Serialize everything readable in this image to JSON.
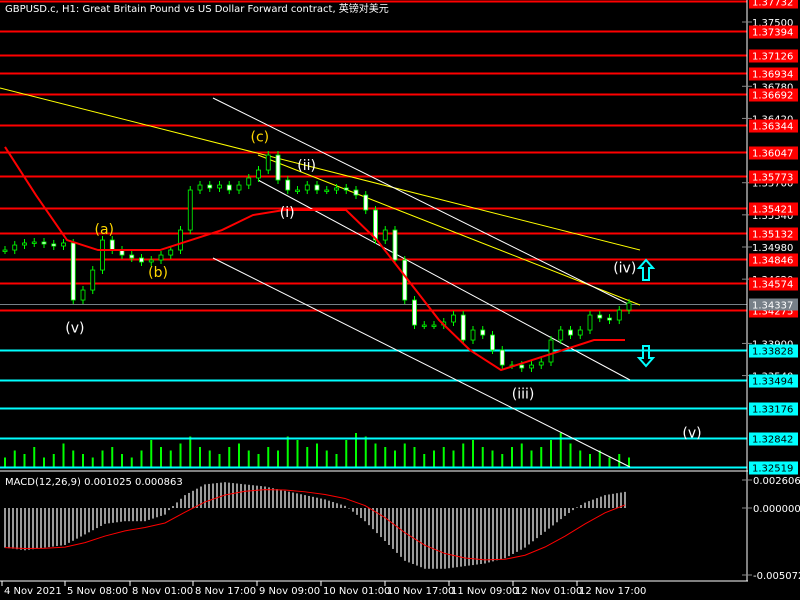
{
  "title": "GBPUSD.c, H1:  Great Britain Pound vs US Dollar Forward contract, 英镑对美元",
  "macd_label": "MACD(12,26,9) 0.001025 0.000863",
  "colors": {
    "background": "#000000",
    "grid": "#5a6a7a",
    "candle": "#00ff00",
    "ma": "#ff0000",
    "resistance": "#ff0000",
    "support": "#00ffff",
    "trend": "#ffff00",
    "channel": "#ffffff",
    "current": "#778088",
    "wave_primary": "#ffffff",
    "wave_secondary": "#ffd700"
  },
  "price_axis": {
    "ticks": [
      "1.37500",
      "1.36780",
      "1.36420",
      "1.35700",
      "1.35340",
      "1.34980",
      "1.34620",
      "1.33900",
      "1.33540"
    ],
    "resistance_levels": [
      "1.37732",
      "1.37394",
      "1.37126",
      "1.36934",
      "1.36692",
      "1.36344",
      "1.36047",
      "1.35773",
      "1.35421",
      "1.35132",
      "1.34846",
      "1.34574",
      "1.34275"
    ],
    "support_levels": [
      "1.33828",
      "1.33494",
      "1.33176",
      "1.32842",
      "1.32519"
    ],
    "current_price": "1.34337"
  },
  "macd_axis": {
    "ticks": [
      "0.002606",
      "0.000000",
      "-0.005072"
    ]
  },
  "time_axis": [
    "4 Nov 2021",
    "5 Nov 08:00",
    "8 Nov 01:00",
    "8 Nov 17:00",
    "9 Nov 09:00",
    "10 Nov 01:00",
    "10 Nov 17:00",
    "11 Nov 09:00",
    "12 Nov 01:00",
    "12 Nov 17:00"
  ],
  "wave_labels": [
    {
      "text": "(v)",
      "price": 1.3408,
      "bar": 7,
      "kind": "primary"
    },
    {
      "text": "(a)",
      "price": 1.3518,
      "bar": 10,
      "kind": "secondary"
    },
    {
      "text": "(b)",
      "price": 1.347,
      "bar": 15.5,
      "kind": "secondary"
    },
    {
      "text": "(c)",
      "price": 1.3622,
      "bar": 26,
      "kind": "secondary"
    },
    {
      "text": "(i)",
      "price": 1.3537,
      "bar": 29,
      "kind": "primary"
    },
    {
      "text": "(ii)",
      "price": 1.359,
      "bar": 30.8,
      "kind": "primary"
    },
    {
      "text": "(iii)",
      "price": 1.3334,
      "bar": 52.8,
      "kind": "primary"
    },
    {
      "text": "(iv)",
      "price": 1.3475,
      "bar": 63.2,
      "kind": "primary"
    },
    {
      "text": "(v)",
      "price": 1.329,
      "bar": 70.3,
      "kind": "primary"
    }
  ],
  "chart_data": {
    "type": "line",
    "symbol": "GBPUSD.c",
    "timeframe": "H1",
    "close": [
      1.34946,
      1.35002,
      1.35025,
      1.35036,
      1.35014,
      1.34991,
      1.35025,
      1.34386,
      1.34498,
      1.34722,
      1.35058,
      1.34946,
      1.3489,
      1.34857,
      1.34812,
      1.34834,
      1.3489,
      1.34946,
      1.3517,
      1.35618,
      1.35674,
      1.35641,
      1.35674,
      1.35618,
      1.35674,
      1.35753,
      1.35842,
      1.3601,
      1.3573,
      1.35618,
      1.35618,
      1.35674,
      1.35618,
      1.35618,
      1.35641,
      1.35618,
      1.35562,
      1.35394,
      1.35058,
      1.3517,
      1.34834,
      1.34386,
      1.34106,
      1.34106,
      1.34106,
      1.3414,
      1.34218,
      1.33938,
      1.3405,
      1.33994,
      1.33826,
      1.33658,
      1.33658,
      1.33625,
      1.33658,
      1.33692,
      1.33938,
      1.3405,
      1.33994,
      1.3405,
      1.34218,
      1.34184,
      1.34162,
      1.34274,
      1.34353
    ],
    "moving_average": [
      1.36101,
      1.3556,
      1.35058,
      1.34946,
      1.34946,
      1.34946,
      1.35058,
      1.3517,
      1.35338,
      1.35394,
      1.35394,
      1.35394,
      1.35058,
      1.3461,
      1.34162,
      1.33826,
      1.33602,
      1.33714,
      1.33826,
      1.33938,
      1.33938
    ],
    "macd_histogram": [
      -0.003,
      -0.0032,
      -0.003,
      -0.0028,
      -0.002,
      -0.0012,
      -0.001,
      -0.001,
      -0.0005,
      0.0012,
      0.0022,
      0.0024,
      0.0022,
      0.002,
      0.0016,
      0.0012,
      0.0008,
      0.0002,
      -0.001,
      -0.0025,
      -0.004,
      -0.0046,
      -0.0046,
      -0.0044,
      -0.0042,
      -0.0038,
      -0.003,
      -0.0018,
      -0.0006,
      0.0005,
      0.0012,
      0.0015
    ],
    "volume": [
      3,
      5,
      4,
      6,
      3,
      4,
      7,
      5,
      4,
      3,
      5,
      6,
      4,
      3,
      5,
      8,
      6,
      5,
      7,
      9,
      6,
      5,
      4,
      6,
      7,
      5,
      4,
      6,
      5,
      9,
      8,
      6,
      7,
      5,
      4,
      8,
      10,
      9,
      7,
      6,
      5,
      7,
      6,
      4,
      5,
      6,
      5,
      7,
      8,
      6,
      5,
      4,
      6,
      7,
      5,
      6,
      8,
      10,
      7,
      5,
      4,
      5,
      3,
      4,
      3
    ],
    "ylim": [
      1.324,
      1.3776
    ],
    "macd_ylim": [
      -0.005072,
      0.002606
    ]
  }
}
